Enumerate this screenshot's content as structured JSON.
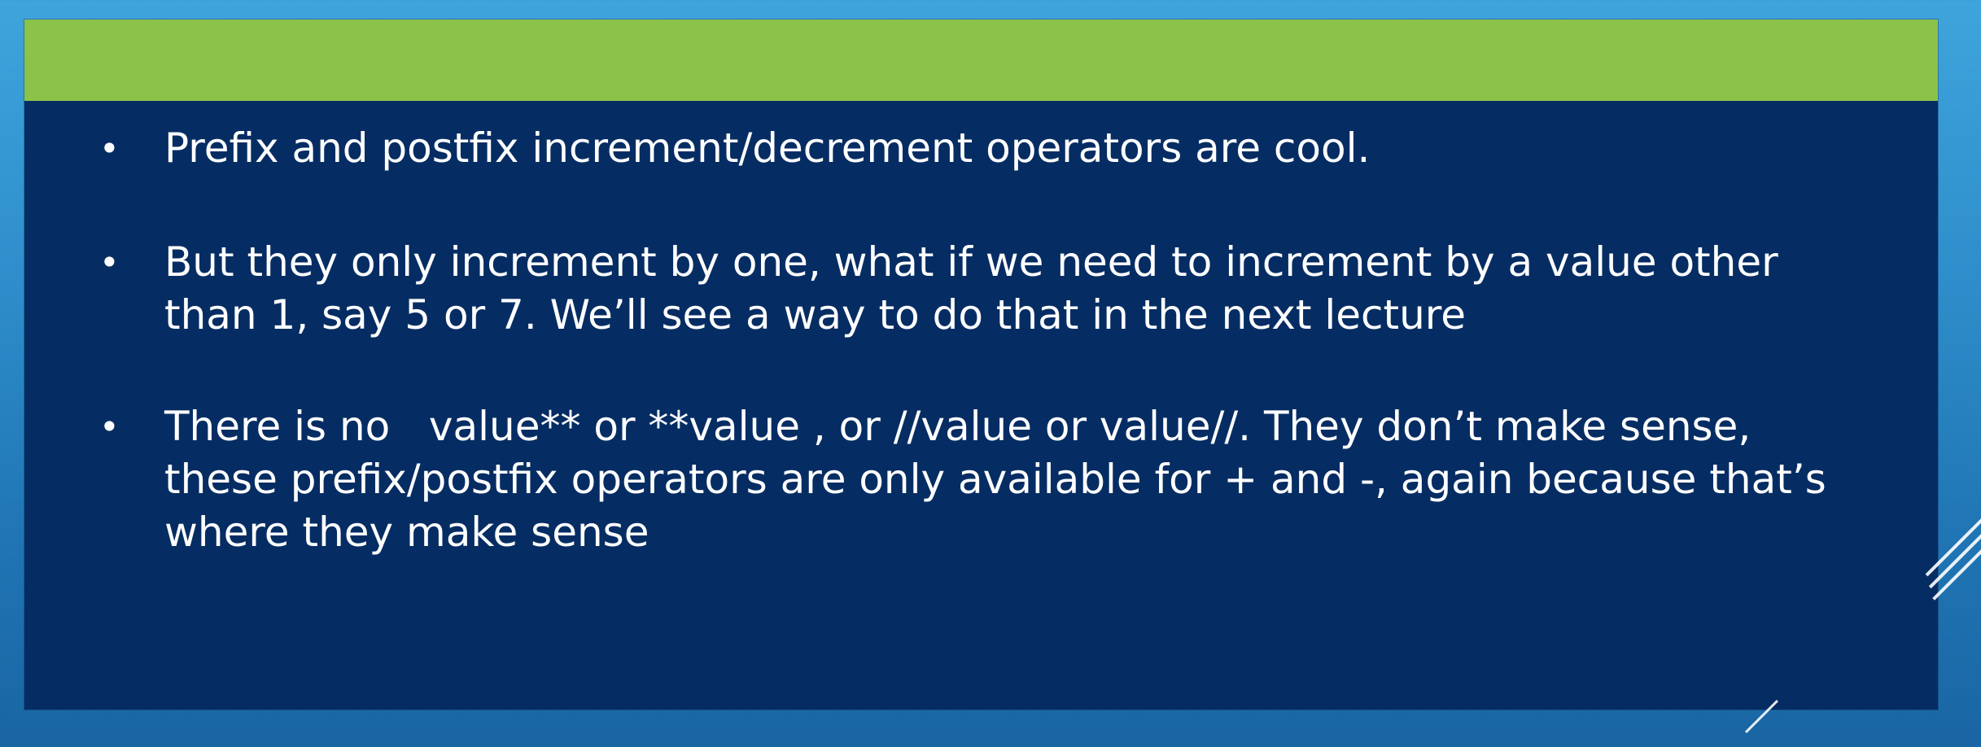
{
  "slide": {
    "bullets": [
      {
        "marker": "•",
        "text": "Prefix and postfix increment/decrement operators are cool."
      },
      {
        "marker": "•",
        "text": "But they only increment by one, what if we need to increment by a value other than 1, say 5 or 7. We’ll see a way to do that in the next lecture"
      },
      {
        "marker": "•",
        "text": "There is no   value** or **value , or //value or value//. They don’t make sense, these prefix/postfix operators are only available for + and -, again because that’s where they make sense"
      }
    ]
  },
  "theme": {
    "title_bar_color": "#8bc34a",
    "panel_color": "#062d63",
    "background_color": "#2f8fcc",
    "text_color": "#ffffff"
  }
}
